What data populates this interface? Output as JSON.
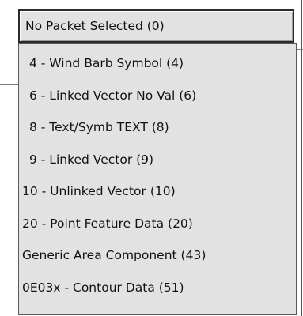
{
  "dropdown": {
    "selected_label": "No Packet Selected (0)",
    "options": [
      "4 - Wind Barb Symbol (4)",
      "6 - Linked Vector No Val (6)",
      "8 - Text/Symb TEXT (8)",
      "9 - Linked Vector (9)",
      "10 - Unlinked Vector (10)",
      "20 - Point Feature Data (20)",
      "Generic Area Component (43)",
      "0E03x - Contour Data (51)"
    ]
  }
}
